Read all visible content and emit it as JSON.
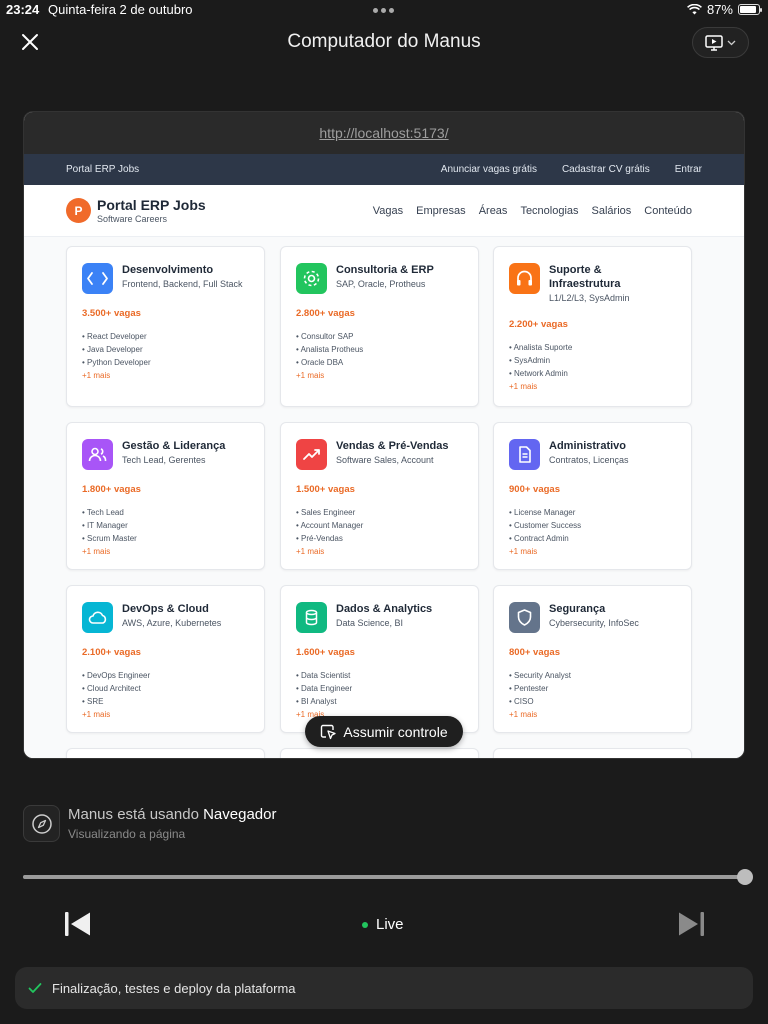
{
  "status": {
    "time": "23:24",
    "date": "Quinta-feira 2 de outubro",
    "battery": "87%",
    "battery_level": 0.87
  },
  "header": {
    "title": "Computador do Manus"
  },
  "browser": {
    "url": "http://localhost:5173/",
    "topnav": {
      "brand": "Portal ERP Jobs",
      "links": [
        "Anunciar vagas grátis",
        "Cadastrar CV grátis",
        "Entrar"
      ]
    },
    "site": {
      "logo_letter": "P",
      "name": "Portal ERP Jobs",
      "tagline": "Software Careers",
      "nav": [
        "Vagas",
        "Empresas",
        "Áreas",
        "Tecnologias",
        "Salários",
        "Conteúdo"
      ]
    },
    "cards": [
      {
        "title": "Desenvolvimento",
        "subtitle": "Frontend, Backend, Full Stack",
        "count": "3.500+ vagas",
        "items": [
          "• React Developer",
          "• Java Developer",
          "• Python Developer"
        ],
        "more": "+1 mais",
        "icon": "code-icon",
        "color": "#3b82f6"
      },
      {
        "title": "Consultoria & ERP",
        "subtitle": "SAP, Oracle, Protheus",
        "count": "2.800+ vagas",
        "items": [
          "• Consultor SAP",
          "• Analista Protheus",
          "• Oracle DBA"
        ],
        "more": "+1 mais",
        "icon": "gear-icon",
        "color": "#22c55e"
      },
      {
        "title": "Suporte & Infraestrutura",
        "subtitle": "L1/L2/L3, SysAdmin",
        "count": "2.200+ vagas",
        "items": [
          "• Analista Suporte",
          "• SysAdmin",
          "• Network Admin"
        ],
        "more": "+1 mais",
        "icon": "headphones-icon",
        "color": "#f97316"
      },
      {
        "title": "Gestão & Liderança",
        "subtitle": "Tech Lead, Gerentes",
        "count": "1.800+ vagas",
        "items": [
          "• Tech Lead",
          "• IT Manager",
          "• Scrum Master"
        ],
        "more": "+1 mais",
        "icon": "users-icon",
        "color": "#a855f7"
      },
      {
        "title": "Vendas & Pré-Vendas",
        "subtitle": "Software Sales, Account",
        "count": "1.500+ vagas",
        "items": [
          "• Sales Engineer",
          "• Account Manager",
          "• Pré-Vendas"
        ],
        "more": "+1 mais",
        "icon": "trending-up-icon",
        "color": "#ef4444"
      },
      {
        "title": "Administrativo",
        "subtitle": "Contratos, Licenças",
        "count": "900+ vagas",
        "items": [
          "• License Manager",
          "• Customer Success",
          "• Contract Admin"
        ],
        "more": "+1 mais",
        "icon": "document-icon",
        "color": "#6366f1"
      },
      {
        "title": "DevOps & Cloud",
        "subtitle": "AWS, Azure, Kubernetes",
        "count": "2.100+ vagas",
        "items": [
          "• DevOps Engineer",
          "• Cloud Architect",
          "• SRE"
        ],
        "more": "+1 mais",
        "icon": "cloud-icon",
        "color": "#06b6d4"
      },
      {
        "title": "Dados & Analytics",
        "subtitle": "Data Science, BI",
        "count": "1.600+ vagas",
        "items": [
          "• Data Scientist",
          "• Data Engineer",
          "• BI Analyst"
        ],
        "more": "+1 mais",
        "icon": "database-icon",
        "color": "#10b981"
      },
      {
        "title": "Segurança",
        "subtitle": "Cybersecurity, InfoSec",
        "count": "800+ vagas",
        "items": [
          "• Security Analyst",
          "• Pentester",
          "• CISO"
        ],
        "more": "+1 mais",
        "icon": "shield-icon",
        "color": "#64748b"
      }
    ]
  },
  "takeover_label": "Assumir controle",
  "tool": {
    "prefix": "Manus está usando",
    "name": "Navegador",
    "status": "Visualizando a página"
  },
  "playback": {
    "progress": 1.0,
    "live_label": "Live"
  },
  "task": {
    "label": "Finalização, testes e deploy da plataforma"
  }
}
